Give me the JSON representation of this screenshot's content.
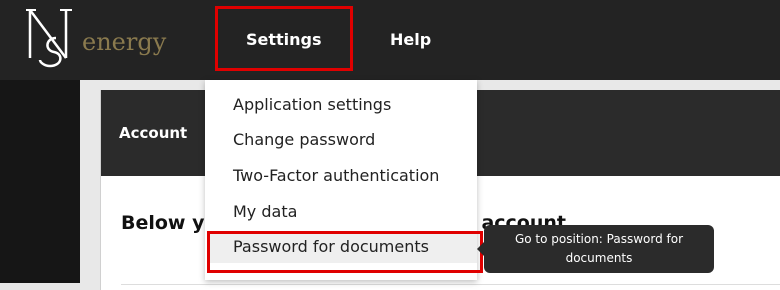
{
  "header": {
    "logo_text": "energy",
    "nav": {
      "settings_label": "Settings",
      "help_label": "Help"
    }
  },
  "page": {
    "card_title": "Account",
    "card_subtitle": "Below y",
    "card_subtitle_tail": "your account"
  },
  "dropdown": {
    "items": [
      {
        "label": "Application settings"
      },
      {
        "label": "Change password"
      },
      {
        "label": "Two-Factor authentication"
      },
      {
        "label": "My data"
      },
      {
        "label": "Password for documents"
      }
    ]
  },
  "tooltip": {
    "text": "Go to position: Password for documents"
  },
  "colors": {
    "topbar": "#232323",
    "highlight": "#e00000",
    "logo_gold": "#8a7a4e"
  }
}
